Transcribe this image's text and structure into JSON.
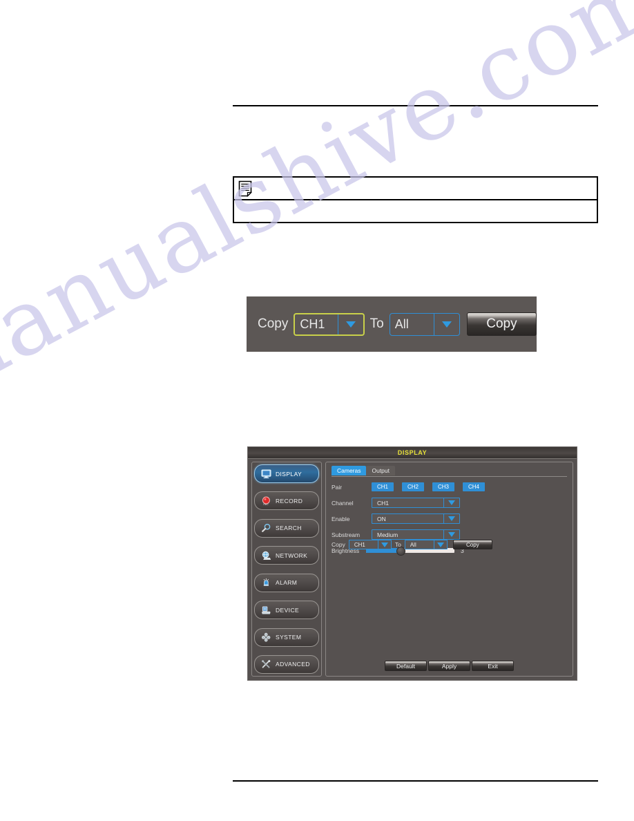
{
  "page": {
    "watermark": "manualshive.com",
    "header_rule": true,
    "footer_rule": true
  },
  "note": {
    "icon": "note-document-icon",
    "heading": "",
    "body": ""
  },
  "copy_bar": {
    "copy_label": "Copy",
    "source_value": "CH1",
    "to_label": "To",
    "target_value": "All",
    "button_label": "Copy"
  },
  "dvr": {
    "title": "DISPLAY",
    "title_color": "#e8e23a",
    "accent_color": "#2f8fd6",
    "sidebar": {
      "items": [
        {
          "label": "DISPLAY",
          "icon": "monitor-icon",
          "active": true
        },
        {
          "label": "RECORD",
          "icon": "record-dot-icon",
          "active": false
        },
        {
          "label": "SEARCH",
          "icon": "magnifier-icon",
          "active": false
        },
        {
          "label": "NETWORK",
          "icon": "globe-icon",
          "active": false
        },
        {
          "label": "ALARM",
          "icon": "bell-icon",
          "active": false
        },
        {
          "label": "DEVICE",
          "icon": "hdd-icon",
          "active": false
        },
        {
          "label": "SYSTEM",
          "icon": "gears-icon",
          "active": false
        },
        {
          "label": "ADVANCED",
          "icon": "tools-icon",
          "active": false
        }
      ]
    },
    "tabs": [
      {
        "label": "Cameras",
        "active": true
      },
      {
        "label": "Output",
        "active": false
      }
    ],
    "form": {
      "pair_label": "Pair",
      "pair_channels": [
        "CH1",
        "CH2",
        "CH3",
        "CH4"
      ],
      "channel_label": "Channel",
      "channel_value": "CH1",
      "enable_label": "Enable",
      "enable_value": "ON",
      "substream_label": "Substream",
      "substream_value": "Medium",
      "brightness_label": "Brightness",
      "brightness_value": "3",
      "brightness_percent": 38
    },
    "copy_row": {
      "copy_label": "Copy",
      "source_value": "CH1",
      "to_label": "To",
      "target_value": "All",
      "button_label": "Copy"
    },
    "actions": [
      {
        "label": "Default"
      },
      {
        "label": "Apply"
      },
      {
        "label": "Exit"
      }
    ]
  }
}
